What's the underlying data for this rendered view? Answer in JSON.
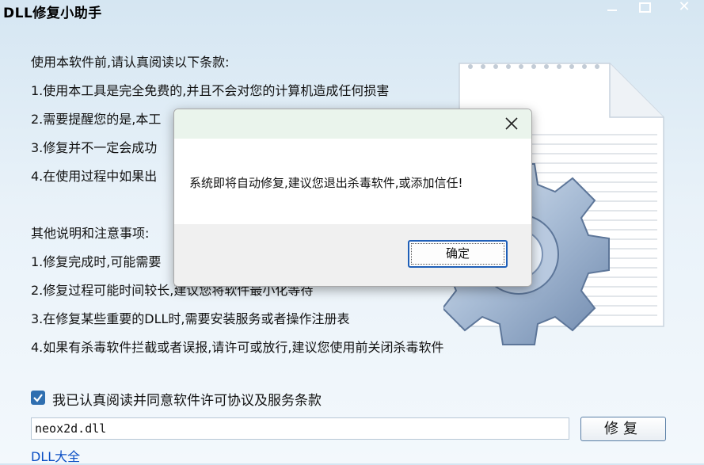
{
  "window": {
    "title": "DLL修复小助手",
    "controls": {
      "minimize": "minimize-icon",
      "maximize": "maximize-icon",
      "close": "close-icon"
    }
  },
  "intro": {
    "lines": [
      "使用本软件前,请认真阅读以下条款:",
      "1.使用本工具是完全免费的,并且不会对您的计算机造成任何损害",
      "2.需要提醒您的是,本工",
      "3.修复并不一定会成功",
      "4.在使用过程中如果出",
      "其他说明和注意事项:",
      "1.修复完成时,可能需要",
      "2.修复过程可能时间较长,建议您将软件最小化等待",
      "3.在修复某些重要的DLL时,需要安装服务或者操作注册表",
      "4.如果有杀毒软件拦截或者误报,请许可或放行,建议您使用前关闭杀毒软件"
    ]
  },
  "agreement": {
    "checked": true,
    "label": "我已认真阅读并同意软件许可协议及服务条款"
  },
  "dll_field": {
    "value": "neox2d.dll"
  },
  "repair_button": {
    "label": "修复"
  },
  "link": {
    "label": "DLL大全"
  },
  "dialog": {
    "message": "系统即将自动修复,建议您退出杀毒软件,或添加信任!",
    "ok_label": "确定",
    "close_icon": "close-icon"
  },
  "colors": {
    "accent": "#2f6fb0",
    "link": "#0b4fc4",
    "dialog_header": "#eaf4ec"
  }
}
